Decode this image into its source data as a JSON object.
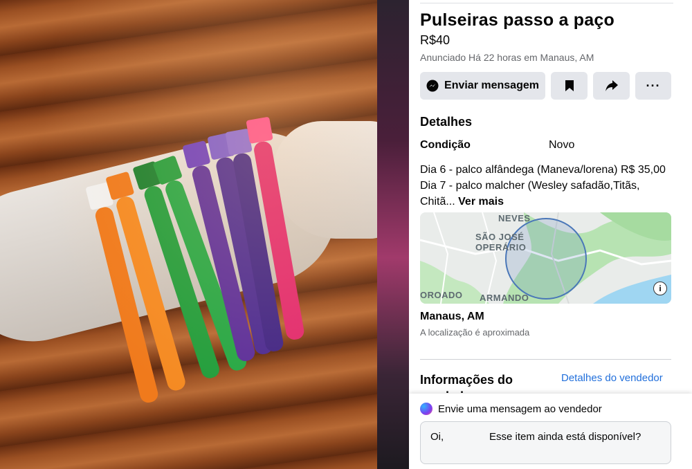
{
  "listing": {
    "title": "Pulseiras passo a paço",
    "price": "R$40",
    "meta": "Anunciado Há 22 horas em Manaus, AM"
  },
  "actions": {
    "message_label": "Enviar mensagem",
    "save_icon": "bookmark-icon",
    "share_icon": "share-icon",
    "more_label": "···"
  },
  "details": {
    "heading": "Detalhes",
    "condition_label": "Condição",
    "condition_value": "Novo",
    "description_line1": "Dia 6 - palco alfândega (Maneva/lorena) R$ 35,00",
    "description_line2": "Dia 7 - palco malcher (Wesley safadão,Titãs,",
    "description_line3": "Chitã...",
    "see_more": "Ver mais"
  },
  "map": {
    "labels": {
      "neves": "NEVES",
      "sao_jose": "SÃO JOSÉ",
      "operario": "OPERÁRIO",
      "oroado": "OROADO",
      "armando": "ARMANDO"
    },
    "info": "i"
  },
  "location": {
    "city": "Manaus, AM",
    "note": "A localização é aproximada"
  },
  "seller": {
    "heading_line1": "Informações do",
    "heading_line2": "vendedor",
    "details_link": "Detalhes do vendedor"
  },
  "message": {
    "title": "Envie uma mensagem ao vendedor",
    "greeting": "Oi,",
    "prefill": "Esse item ainda está disponível?"
  },
  "colors": {
    "link": "#216fdb",
    "button_bg": "#e4e6eb",
    "secondary_text": "#65676b"
  }
}
